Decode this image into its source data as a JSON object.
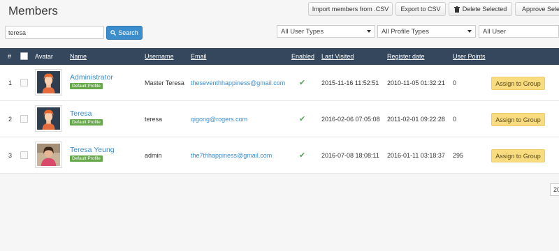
{
  "page": {
    "title": "Members"
  },
  "toolbar": {
    "import_label": "Import members from .CSV",
    "export_label": "Export to CSV",
    "delete_label": "Delete Selected",
    "approve_label": "Approve Sele"
  },
  "search": {
    "value": "teresa",
    "button_label": "Search"
  },
  "filters": {
    "user_types": "All User Types",
    "profile_types": "All Profile Types",
    "users": "All User"
  },
  "table": {
    "headers": {
      "index": "#",
      "avatar": "Avatar",
      "name": "Name",
      "username": "Username",
      "email": "Email",
      "enabled": "Enabled",
      "last_visited": "Last Visited",
      "register_date": "Register date",
      "user_points": "User Points"
    },
    "rows": [
      {
        "index": "1",
        "name": "Administrator",
        "profile": "Default Profile",
        "username": "Master Teresa",
        "email": "theseventhhappiness@gmail.com",
        "enabled": "✔",
        "last_visited": "2015-11-16 11:52:51",
        "register_date": "2010-11-05 01:32:21",
        "points": "0",
        "action": "Assign to Group",
        "avatar_icon": "default-avatar-icon"
      },
      {
        "index": "2",
        "name": "Teresa",
        "profile": "Default Profile",
        "username": "teresa",
        "email": "qigong@rogers.com",
        "enabled": "✔",
        "last_visited": "2016-02-06 07:05:08",
        "register_date": "2011-02-01 09:22:28",
        "points": "0",
        "action": "Assign to Group",
        "avatar_icon": "default-avatar-icon"
      },
      {
        "index": "3",
        "name": "Teresa Yeung",
        "profile": "Default Profile",
        "username": "admin",
        "email": "the7thhappiness@gmail.com",
        "enabled": "✔",
        "last_visited": "2016-07-08 18:08:11",
        "register_date": "2016-01-11 03:18:37",
        "points": "295",
        "action": "Assign to Group",
        "avatar_icon": "user-photo"
      }
    ]
  },
  "pagination": {
    "page_size": "20"
  },
  "colors": {
    "header_bg": "#35475c",
    "link": "#3c8dcb",
    "badge": "#67a94a",
    "assign_button": "#f8dc7f",
    "search_button": "#3c8dcb"
  }
}
